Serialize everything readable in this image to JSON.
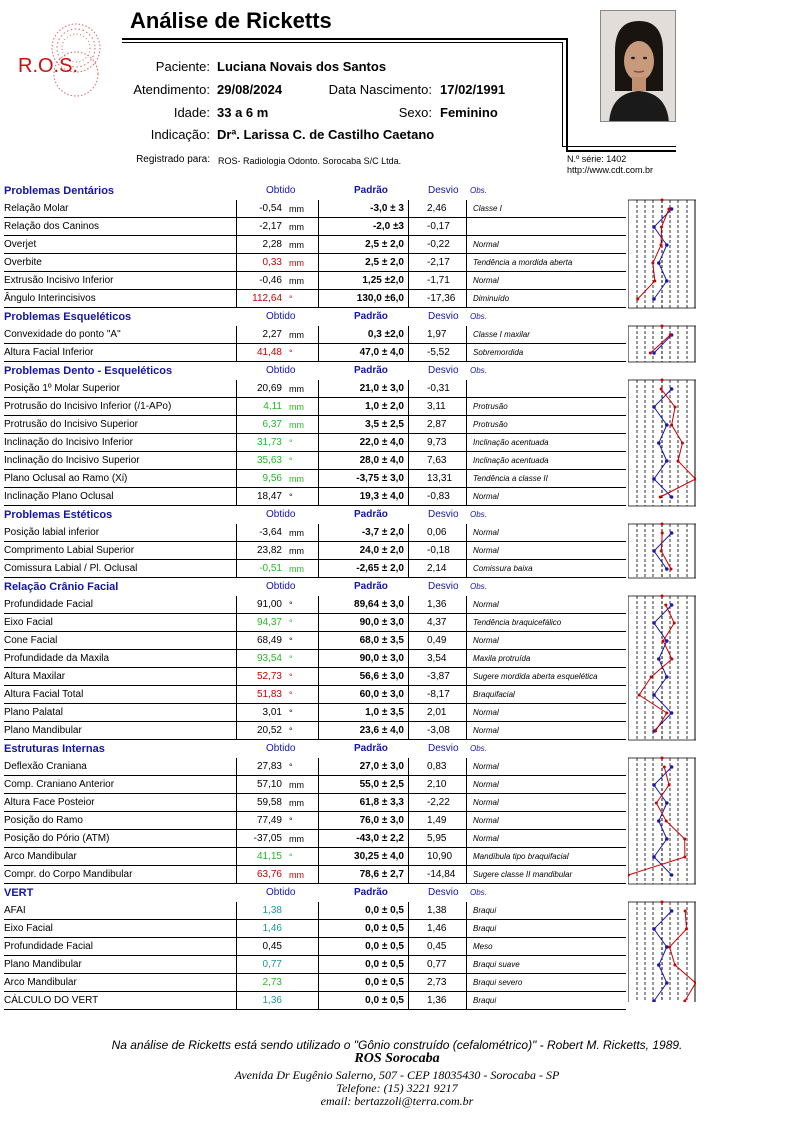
{
  "header": {
    "logo_text": "R.O.S.",
    "title": "Análise de Ricketts",
    "paciente_label": "Paciente:",
    "paciente": "Luciana Novais dos Santos",
    "atendimento_label": "Atendimento:",
    "atendimento": "29/08/2024",
    "nascimento_label": "Data Nascimento:",
    "nascimento": "17/02/1991",
    "idade_label": "Idade:",
    "idade": "33 a 6 m",
    "sexo_label": "Sexo:",
    "sexo": "Feminino",
    "indicacao_label": "Indicação:",
    "indicacao": "Drª. Larissa C. de Castilho Caetano",
    "registrado_label": "Registrado para:",
    "registrado": "ROS- Radiologia Odonto. Sorocaba S/C Ltda.",
    "serie": "N.º série: 1402",
    "site": "http://www.cdt.com.br"
  },
  "sections": [
    {
      "title": "Problemas Dentários",
      "h_obtido": "Obtido",
      "h_padrao": "Padrão",
      "h_desvio": "Desvio",
      "h_obs": "Obs.",
      "rows": [
        {
          "name": "Relação Molar",
          "obtido": "-0,54",
          "unit": "mm",
          "padrao": "-3,0 ± 3",
          "desvio": "2,46",
          "obs": "Classe I",
          "color": ""
        },
        {
          "name": "Relação dos Caninos",
          "obtido": "-2,17",
          "unit": "mm",
          "padrao": "-2,0 ±3",
          "desvio": "-0,17",
          "obs": "",
          "color": ""
        },
        {
          "name": "Overjet",
          "obtido": "2,28",
          "unit": "mm",
          "padrao": "2,5 ± 2,0",
          "desvio": "-0,22",
          "obs": "Normal",
          "color": ""
        },
        {
          "name": "Overbite",
          "obtido": "0,33",
          "unit": "mm",
          "padrao": "2,5 ± 2,0",
          "desvio": "-2,17",
          "obs": "Tendência a mordida aberta",
          "color": "red"
        },
        {
          "name": "Extrusão Incisivo Inferior",
          "obtido": "-0,46",
          "unit": "mm",
          "padrao": "1,25 ±2,0",
          "desvio": "-1,71",
          "obs": "Normal",
          "color": ""
        },
        {
          "name": "Ângulo Interincisivos",
          "obtido": "112,64",
          "unit": "°",
          "padrao": "130,0 ±6,0",
          "desvio": "-17,36",
          "obs": "Diminuído",
          "color": "red"
        }
      ]
    },
    {
      "title": "Problemas Esqueléticos",
      "h_obtido": "Obtido",
      "h_padrao": "Padrão",
      "h_desvio": "Desvio",
      "h_obs": "Obs.",
      "rows": [
        {
          "name": "Convexidade do ponto \"A\"",
          "obtido": "2,27",
          "unit": "mm",
          "padrao": "0,3 ±2,0",
          "desvio": "1,97",
          "obs": "Classe I maxilar",
          "color": ""
        },
        {
          "name": "Altura Facial Inferior",
          "obtido": "41,48",
          "unit": "°",
          "padrao": "47,0 ± 4,0",
          "desvio": "-5,52",
          "obs": "Sobremordida",
          "color": "red"
        }
      ]
    },
    {
      "title": "Problemas Dento - Esqueléticos",
      "h_obtido": "Obtido",
      "h_padrao": "Padrão",
      "h_desvio": "Desvio",
      "h_obs": "Obs.",
      "rows": [
        {
          "name": "Posição 1º Molar Superior",
          "obtido": "20,69",
          "unit": "mm",
          "padrao": "21,0 ± 3,0",
          "desvio": "-0,31",
          "obs": "",
          "color": ""
        },
        {
          "name": "Protrusão do Incisivo Inferior  (/1-APo)",
          "obtido": "4,11",
          "unit": "mm",
          "padrao": "1,0 ± 2,0",
          "desvio": "3,11",
          "obs": "Protrusão",
          "color": "green"
        },
        {
          "name": "Protrusão do Incisivo Superior",
          "obtido": "6,37",
          "unit": "mm",
          "padrao": "3,5 ± 2,5",
          "desvio": "2,87",
          "obs": "Protrusão",
          "color": "green"
        },
        {
          "name": "Inclinação do Incisivo Inferior",
          "obtido": "31,73",
          "unit": "°",
          "padrao": "22,0 ± 4,0",
          "desvio": "9,73",
          "obs": "Inclinação acentuada",
          "color": "green"
        },
        {
          "name": "Inclinação do Incisivo Superior",
          "obtido": "35,63",
          "unit": "°",
          "padrao": "28,0 ± 4,0",
          "desvio": "7,63",
          "obs": "Inclinação acentuada",
          "color": "green"
        },
        {
          "name": "Plano Oclusal ao Ramo (Xi)",
          "obtido": "9,56",
          "unit": "mm",
          "padrao": "-3,75 ± 3,0",
          "desvio": "13,31",
          "obs": "Tendência a classe II",
          "color": "green"
        },
        {
          "name": "Inclinação Plano Oclusal",
          "obtido": "18,47",
          "unit": "°",
          "padrao": "19,3 ± 4,0",
          "desvio": "-0,83",
          "obs": "Normal",
          "color": ""
        }
      ]
    },
    {
      "title": "Problemas Estéticos",
      "h_obtido": "Obtido",
      "h_padrao": "Padrão",
      "h_desvio": "Desvio",
      "h_obs": "Obs.",
      "rows": [
        {
          "name": "Posição labial inferior",
          "obtido": "-3,64",
          "unit": "mm",
          "padrao": "-3,7 ± 2,0",
          "desvio": "0,06",
          "obs": "Normal",
          "color": ""
        },
        {
          "name": "Comprimento Labial Superior",
          "obtido": "23,82",
          "unit": "mm",
          "padrao": "24,0 ± 2,0",
          "desvio": "-0,18",
          "obs": "Normal",
          "color": ""
        },
        {
          "name": "Comissura Labial / Pl. Oclusal",
          "obtido": "-0,51",
          "unit": "mm",
          "padrao": "-2,65 ± 2,0",
          "desvio": "2,14",
          "obs": "Comissura baixa",
          "color": "green"
        }
      ]
    },
    {
      "title": "Relação Crânio Facial",
      "h_obtido": "Obtido",
      "h_padrao": "Padrão",
      "h_desvio": "Desvio",
      "h_obs": "Obs.",
      "rows": [
        {
          "name": "Profundidade Facial",
          "obtido": "91,00",
          "unit": "°",
          "padrao": "89,64 ± 3,0",
          "desvio": "1,36",
          "obs": "Normal",
          "color": ""
        },
        {
          "name": "Eixo Facial",
          "obtido": "94,37",
          "unit": "°",
          "padrao": "90,0 ± 3,0",
          "desvio": "4,37",
          "obs": "Tendência braquicefálico",
          "color": "green"
        },
        {
          "name": "Cone Facial",
          "obtido": "68,49",
          "unit": "°",
          "padrao": "68,0 ± 3,5",
          "desvio": "0,49",
          "obs": "Normal",
          "color": ""
        },
        {
          "name": "Profundidade da Maxila",
          "obtido": "93,54",
          "unit": "°",
          "padrao": "90,0 ± 3,0",
          "desvio": "3,54",
          "obs": "Maxila protruída",
          "color": "green"
        },
        {
          "name": "Altura Maxilar",
          "obtido": "52,73",
          "unit": "°",
          "padrao": "56,6 ± 3,0",
          "desvio": "-3,87",
          "obs": "Sugere mordida aberta esquelética",
          "color": "red"
        },
        {
          "name": "Altura Facial Total",
          "obtido": "51,83",
          "unit": "°",
          "padrao": "60,0 ± 3,0",
          "desvio": "-8,17",
          "obs": "Braquifacial",
          "color": "red"
        },
        {
          "name": "Plano Palatal",
          "obtido": "3,01",
          "unit": "°",
          "padrao": "1,0 ± 3,5",
          "desvio": "2,01",
          "obs": "Normal",
          "color": ""
        },
        {
          "name": "Plano Mandibular",
          "obtido": "20,52",
          "unit": "°",
          "padrao": "23,6 ± 4,0",
          "desvio": "-3,08",
          "obs": "Normal",
          "color": ""
        }
      ]
    },
    {
      "title": "Estruturas Internas",
      "h_obtido": "Obtido",
      "h_padrao": "Padrão",
      "h_desvio": "Desvio",
      "h_obs": "Obs.",
      "rows": [
        {
          "name": "Deflexão Craniana",
          "obtido": "27,83",
          "unit": "°",
          "padrao": "27,0 ± 3,0",
          "desvio": "0,83",
          "obs": "Normal",
          "color": ""
        },
        {
          "name": "Comp. Craniano Anterior",
          "obtido": "57,10",
          "unit": "mm",
          "padrao": "55,0 ± 2,5",
          "desvio": "2,10",
          "obs": "Normal",
          "color": ""
        },
        {
          "name": "Altura Face Posteior",
          "obtido": "59,58",
          "unit": "mm",
          "padrao": "61,8 ± 3,3",
          "desvio": "-2,22",
          "obs": "Normal",
          "color": ""
        },
        {
          "name": "Posição do Ramo",
          "obtido": "77,49",
          "unit": "°",
          "padrao": "76,0 ± 3,0",
          "desvio": "1,49",
          "obs": "Normal",
          "color": ""
        },
        {
          "name": "Posição do Pório (ATM)",
          "obtido": "-37,05",
          "unit": "mm",
          "padrao": "-43,0 ± 2,2",
          "desvio": "5,95",
          "obs": "Normal",
          "color": ""
        },
        {
          "name": "Arco Mandibular",
          "obtido": "41,15",
          "unit": "°",
          "padrao": "30,25 ± 4,0",
          "desvio": "10,90",
          "obs": "Mandíbula tipo braquifacial",
          "color": "green"
        },
        {
          "name": "Compr. do Corpo Mandibular",
          "obtido": "63,76",
          "unit": "mm",
          "padrao": "78,6 ± 2,7",
          "desvio": "-14,84",
          "obs": "Sugere classe II mandibular",
          "color": "red"
        }
      ]
    },
    {
      "title": "VERT",
      "h_obtido": "Obtido",
      "h_padrao": "Padrão",
      "h_desvio": "Desvio",
      "h_obs": "Obs.",
      "rows": [
        {
          "name": "AFAI",
          "obtido": "1,38",
          "unit": "",
          "padrao": "0,0 ± 0,5",
          "desvio": "1,38",
          "obs": "Braqui",
          "color": "teal"
        },
        {
          "name": "Eixo Facial",
          "obtido": "1,46",
          "unit": "",
          "padrao": "0,0 ± 0,5",
          "desvio": "1,46",
          "obs": "Braqui",
          "color": "teal"
        },
        {
          "name": "Profundidade Facial",
          "obtido": "0,45",
          "unit": "",
          "padrao": "0,0 ± 0,5",
          "desvio": "0,45",
          "obs": "Meso",
          "color": ""
        },
        {
          "name": "Plano Mandibular",
          "obtido": "0,77",
          "unit": "",
          "padrao": "0,0 ± 0,5",
          "desvio": "0,77",
          "obs": "Braqui suave",
          "color": "teal"
        },
        {
          "name": "Arco Mandibular",
          "obtido": "2,73",
          "unit": "",
          "padrao": "0,0 ± 0,5",
          "desvio": "2,73",
          "obs": "Braqui severo",
          "color": "green"
        },
        {
          "name": "CÁLCULO  DO  VERT",
          "obtido": "1,36",
          "unit": "",
          "padrao": "0,0 ± 0,5",
          "desvio": "1,36",
          "obs": "Braqui",
          "color": "teal"
        }
      ]
    }
  ],
  "footer": {
    "note": "Na análise de Ricketts  está sendo utilizado o \"Gônio construído (cefalométrico)\" - Robert M. Ricketts, 1989.",
    "clinic": "ROS Sorocaba",
    "address": "Avenida  Dr Eugênio Salerno, 507 - CEP 18035430  - Sorocaba - SP",
    "phone": "Telefone: (15) 3221 9217",
    "email": "email: bertazzoli@terra.com.br"
  },
  "colors": {
    "section_blue": "#1414a8",
    "red": "#d00000",
    "green": "#22bb22",
    "teal": "#189a9a"
  }
}
